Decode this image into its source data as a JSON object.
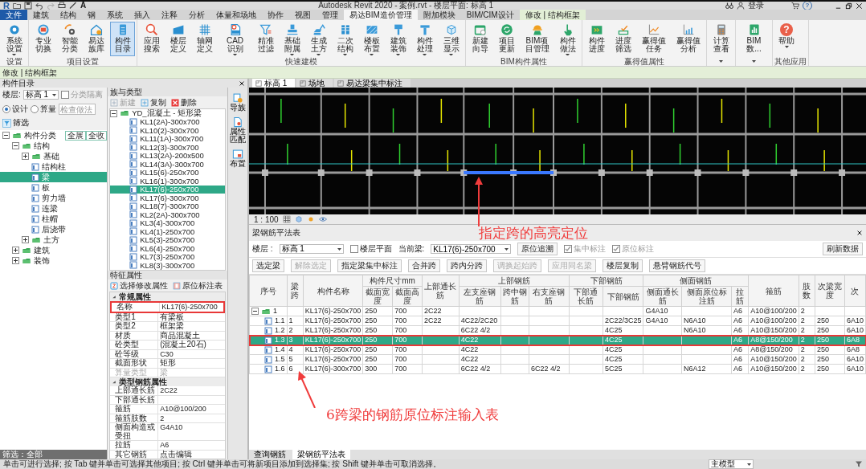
{
  "title_bar": {
    "logo": "R",
    "text_tool": "A",
    "title": "Autodesk Revit 2020 - 案例.rvt - 楼层平面: 标高 1",
    "user": "登录",
    "help": "?"
  },
  "tabs": [
    {
      "label": "文件",
      "kind": "file",
      "selected": false
    },
    {
      "label": "建筑",
      "kind": "normal",
      "selected": false
    },
    {
      "label": "结构",
      "kind": "normal",
      "selected": false
    },
    {
      "label": "钢",
      "kind": "normal",
      "selected": false
    },
    {
      "label": "系统",
      "kind": "normal",
      "selected": false
    },
    {
      "label": "插入",
      "kind": "normal",
      "selected": false
    },
    {
      "label": "注释",
      "kind": "normal",
      "selected": false
    },
    {
      "label": "分析",
      "kind": "normal",
      "selected": false
    },
    {
      "label": "体量和场地",
      "kind": "normal",
      "selected": false
    },
    {
      "label": "协作",
      "kind": "normal",
      "selected": false
    },
    {
      "label": "视图",
      "kind": "normal",
      "selected": false
    },
    {
      "label": "管理",
      "kind": "normal",
      "selected": false
    },
    {
      "label": "易达BIM造价管理",
      "kind": "normal",
      "selected": true
    },
    {
      "label": "附加模块",
      "kind": "normal",
      "selected": false
    },
    {
      "label": "BIM/CIM设计",
      "kind": "normal",
      "selected": false
    },
    {
      "label": "修改 | 结构框架",
      "kind": "context",
      "selected": false
    }
  ],
  "ribbon": {
    "groups": [
      {
        "label": "设置",
        "buttons": [
          {
            "label": "系统设置",
            "dropdown": true,
            "selected": false
          }
        ]
      },
      {
        "label": "项目设置",
        "buttons": [
          {
            "label": "专业切换",
            "dropdown": false,
            "selected": false
          },
          {
            "label": "智能分类",
            "dropdown": false,
            "selected": false
          },
          {
            "label": "易达族库",
            "dropdown": false,
            "selected": false
          },
          {
            "label": "构件目录",
            "dropdown": false,
            "selected": true
          }
        ]
      },
      {
        "label": "快速建模",
        "buttons": [
          {
            "label": "应用搜索",
            "dropdown": false,
            "selected": false
          },
          {
            "label": "楼层定义",
            "dropdown": false,
            "selected": false
          },
          {
            "label": "轴网定义",
            "dropdown": false,
            "selected": false
          },
          {
            "label": "CAD识别",
            "dropdown": true,
            "selected": false
          },
          {
            "label": "精准过滤",
            "dropdown": false,
            "selected": false
          },
          {
            "label": "基础附属",
            "dropdown": true,
            "selected": false
          },
          {
            "label": "生成土方",
            "dropdown": true,
            "selected": false
          },
          {
            "label": "二次结构",
            "dropdown": true,
            "selected": false
          },
          {
            "label": "楼板布置",
            "dropdown": true,
            "selected": false
          },
          {
            "label": "建筑装饰",
            "dropdown": true,
            "selected": false
          },
          {
            "label": "构件处理",
            "dropdown": true,
            "selected": false
          },
          {
            "label": "三维显示",
            "dropdown": true,
            "selected": false
          }
        ]
      },
      {
        "label": "BIM构件属性",
        "buttons": [
          {
            "label": "新建向导",
            "dropdown": false,
            "selected": false
          },
          {
            "label": "项目更新",
            "dropdown": false,
            "selected": false
          },
          {
            "label": "BIM项目管理",
            "dropdown": false,
            "selected": false
          },
          {
            "label": "构件做法",
            "dropdown": true,
            "selected": false
          }
        ]
      },
      {
        "label": "赢得值属性",
        "buttons": [
          {
            "label": "构件进度",
            "dropdown": false,
            "selected": false
          },
          {
            "label": "进度筛选",
            "dropdown": false,
            "selected": false
          },
          {
            "label": "赢得值任务",
            "dropdown": false,
            "selected": false
          },
          {
            "label": "赢得值分析",
            "dropdown": false,
            "selected": false
          }
        ]
      },
      {
        "buttons": [
          {
            "label": "计算查看",
            "dropdown": false,
            "selected": false
          }
        ]
      },
      {
        "buttons": [
          {
            "label": "BIM数...",
            "dropdown": false,
            "selected": false
          }
        ]
      },
      {
        "label": "其他应用",
        "buttons": [
          {
            "label": "帮助",
            "dropdown": true,
            "selected": false,
            "glyph": "?"
          }
        ]
      }
    ]
  },
  "context_bar": "修改 | 结构框架",
  "component_panel": {
    "title": "构件目录",
    "floor_label": "楼层:",
    "floor_value": "标高 1",
    "isolate": {
      "label": "分类隔离",
      "checked": false,
      "disabled": true
    },
    "modes": [
      {
        "label": "设计",
        "selected": true
      },
      {
        "label": "算量",
        "selected": false
      }
    ],
    "search_placeholder": "检查做法",
    "filter_button": "筛选",
    "expand_all": "全展",
    "collapse_all": "全收",
    "tree": [
      {
        "label": "构件分类",
        "kind": "group",
        "expanded": true,
        "selected": false,
        "children": [
          {
            "label": "结构",
            "kind": "group",
            "expanded": true,
            "selected": false,
            "children": [
              {
                "label": "基础",
                "kind": "group",
                "expanded": false,
                "selected": false
              },
              {
                "label": "结构柱",
                "kind": "item",
                "selected": false
              },
              {
                "label": "梁",
                "kind": "item",
                "selected": true
              },
              {
                "label": "板",
                "kind": "item",
                "selected": false
              },
              {
                "label": "剪力墙",
                "kind": "item",
                "selected": false
              },
              {
                "label": "连梁",
                "kind": "item",
                "selected": false
              },
              {
                "label": "柱帽",
                "kind": "item",
                "selected": false
              },
              {
                "label": "后浇带",
                "kind": "item",
                "selected": false
              },
              {
                "label": "土方",
                "kind": "group",
                "expanded": false,
                "selected": false
              }
            ]
          },
          {
            "label": "建筑",
            "kind": "group",
            "expanded": false,
            "selected": false
          },
          {
            "label": "装饰",
            "kind": "group",
            "expanded": false,
            "selected": false
          }
        ]
      }
    ],
    "footer": "筛选：全部"
  },
  "family_panel": {
    "title": "族与类型",
    "actions": [
      {
        "label": "新建",
        "disabled": true
      },
      {
        "label": "复制",
        "disabled": false
      },
      {
        "label": "删除",
        "disabled": false
      }
    ],
    "root": {
      "label": "YD_混凝土 - 矩形梁",
      "expanded": true,
      "children": [
        {
          "label": "KL1(2A)-300x700",
          "selected": false
        },
        {
          "label": "KL10(2)-300x700",
          "selected": false
        },
        {
          "label": "KL11(1A)-300x700",
          "selected": false
        },
        {
          "label": "KL12(3)-300x700",
          "selected": false
        },
        {
          "label": "KL13(2A)-200x500",
          "selected": false
        },
        {
          "label": "KL14(3A)-300x700",
          "selected": false
        },
        {
          "label": "KL15(6)-250x700",
          "selected": false
        },
        {
          "label": "KL16(1)-300x700",
          "selected": false
        },
        {
          "label": "KL17(6)-250x700",
          "selected": true
        },
        {
          "label": "KL17(6)-300x700",
          "selected": false
        },
        {
          "label": "KL18(7)-300x700",
          "selected": false
        },
        {
          "label": "KL2(2A)-300x700",
          "selected": false
        },
        {
          "label": "KL3(4)-300x700",
          "selected": false
        },
        {
          "label": "KL4(1)-250x700",
          "selected": false
        },
        {
          "label": "KL5(3)-250x700",
          "selected": false
        },
        {
          "label": "KL6(4)-250x700",
          "selected": false
        },
        {
          "label": "KL7(3)-250x700",
          "selected": false
        },
        {
          "label": "KL8(3)-300x700",
          "selected": false
        }
      ]
    }
  },
  "side_tools": [
    {
      "label": "导族"
    },
    {
      "label": "属性匹配"
    },
    {
      "label": "布置"
    }
  ],
  "properties": {
    "title": "特征属性",
    "actions": [
      "选择修改属性",
      "原位标注表"
    ],
    "sections": [
      {
        "label": "常规属性",
        "expanded": true,
        "rows": [
          {
            "label": "名称",
            "value": "KL17(6)-250x700",
            "disabled": false,
            "outlined": true
          },
          {
            "label": "类型1",
            "value": "有梁板",
            "disabled": false,
            "outlined": false
          },
          {
            "label": "类型2",
            "value": "框架梁",
            "disabled": false,
            "outlined": false
          },
          {
            "label": "材质",
            "value": "商品混凝土",
            "disabled": false,
            "outlined": false
          },
          {
            "label": "砼类型",
            "value": "(混凝土20石)",
            "disabled": false,
            "outlined": false
          },
          {
            "label": "砼等级",
            "value": "C30",
            "disabled": false,
            "outlined": false
          },
          {
            "label": "截面形状",
            "value": "矩形",
            "disabled": false,
            "outlined": false
          },
          {
            "label": "算量类型",
            "value": "梁",
            "disabled": true,
            "outlined": false
          }
        ]
      },
      {
        "label": "类型钢筋属性",
        "expanded": true,
        "rows": [
          {
            "label": "上部通长筋",
            "value": "2C22",
            "disabled": false,
            "outlined": false
          },
          {
            "label": "下部通长筋",
            "disabled": false,
            "outlined": false
          },
          {
            "label": "箍筋",
            "value": "A10@100/200",
            "disabled": false,
            "outlined": false
          },
          {
            "label": "箍筋肢数",
            "value": "2",
            "disabled": false,
            "outlined": false
          },
          {
            "label": "侧面构造或受扭",
            "value": "G4A10",
            "disabled": false,
            "outlined": false
          },
          {
            "label": "拉筋",
            "value": "A6",
            "disabled": false,
            "outlined": false
          },
          {
            "label": "其它钢筋",
            "value": "点击编辑",
            "disabled": false,
            "outlined": false
          }
        ]
      }
    ]
  },
  "view_tabs": [
    {
      "label": "标高 1",
      "selected": true
    },
    {
      "label": "场地",
      "selected": false
    },
    {
      "label": "易达梁集中标注",
      "selected": false
    }
  ],
  "view_scale": "1 : 100",
  "rebar_table": {
    "title": "梁钢筋平法表",
    "callout": "指定跨的高亮定位",
    "floor_label": "楼层 :",
    "floor_value": "标高 1",
    "floor_plan": {
      "label": "楼层平面",
      "checked": false,
      "disabled": false
    },
    "beam_label": "当前梁:",
    "beam_value": "KL17(6)-250x700",
    "trace_button": "原位追溯",
    "options": [
      {
        "label": "集中标注",
        "checked": true,
        "disabled": true
      },
      {
        "label": "原位标注",
        "checked": true,
        "disabled": true
      }
    ],
    "refresh_button": "刷新数据",
    "actions": [
      {
        "label": "选定梁",
        "disabled": false
      },
      {
        "label": "解除选定",
        "disabled": true
      },
      {
        "label": "指定梁集中标注",
        "disabled": false
      },
      {
        "label": "合并跨",
        "disabled": false
      },
      {
        "label": "跨内分跨",
        "disabled": false
      },
      {
        "label": "调换起始跨",
        "disabled": true
      },
      {
        "label": "应用同名梁",
        "disabled": true
      },
      {
        "label": "楼层复制",
        "disabled": false
      },
      {
        "label": "悬臂钢筋代号",
        "disabled": false
      }
    ],
    "columns": [
      {
        "label": "序号"
      },
      {
        "label": "梁跨"
      },
      {
        "label": "构件名称"
      },
      {
        "label": "构件尺寸mm",
        "colspan": 2,
        "children": [
          "截面宽度",
          "截面高度"
        ]
      },
      {
        "label": "上部通长筋"
      },
      {
        "label": "上部钢筋",
        "colspan": 3,
        "children": [
          "左支座钢筋",
          "跨中钢筋",
          "右支座钢筋"
        ]
      },
      {
        "label": "下部钢筋",
        "colspan": 2,
        "children": [
          "下部通长筋",
          "下部钢筋"
        ]
      },
      {
        "label": "侧面钢筋",
        "colspan": 3,
        "children": [
          "侧面通长筋",
          "侧面原位标注筋",
          "拉筋"
        ]
      },
      {
        "label": "箍筋"
      },
      {
        "label": "肢数"
      },
      {
        "label": "次梁宽度"
      },
      {
        "label": "次"
      }
    ],
    "rows": [
      {
        "expanded": true,
        "selected": false,
        "outlined": false,
        "cells": [
          "1",
          "",
          "KL17(6)-250x700",
          "250",
          "700",
          "2C22",
          "",
          "",
          "",
          "",
          "",
          "G4A10",
          "",
          "A6",
          "A10@100/200",
          "2",
          "",
          ""
        ],
        "children": [
          {
            "selected": false,
            "outlined": false,
            "cells": [
              "1.1",
              "1",
              "KL17(6)-250x700",
              "250",
              "700",
              "2C22",
              "4C22/2C20",
              "",
              "",
              "",
              "2C22/3C25",
              "G4A10",
              "N6A10",
              "A6",
              "A10@100/200",
              "2",
              "250",
              "6A10"
            ]
          },
          {
            "selected": false,
            "outlined": false,
            "cells": [
              "1.2",
              "2",
              "KL17(6)-250x700",
              "250",
              "700",
              "",
              "6C22 4/2",
              "",
              "",
              "",
              "4C25",
              "",
              "N6A10",
              "A6",
              "A10@150/200",
              "2",
              "250",
              "6A10"
            ]
          },
          {
            "selected": true,
            "outlined": true,
            "cells": [
              "1.3",
              "3",
              "KL17(6)-250x700",
              "250",
              "700",
              "",
              "4C22",
              "",
              "",
              "",
              "4C25",
              "",
              "",
              "A6",
              "A8@150/200",
              "2",
              "250",
              "6A8"
            ]
          },
          {
            "selected": false,
            "outlined": false,
            "cells": [
              "1.4",
              "4",
              "KL17(6)-250x700",
              "250",
              "700",
              "",
              "4C22",
              "",
              "",
              "",
              "4C25",
              "",
              "",
              "A6",
              "A8@150/200",
              "2",
              "250",
              "6A8"
            ]
          },
          {
            "selected": false,
            "outlined": false,
            "cells": [
              "1.5",
              "5",
              "KL17(6)-250x700",
              "250",
              "700",
              "",
              "4C22",
              "",
              "",
              "",
              "4C25",
              "",
              "",
              "A6",
              "A10@150/200",
              "2",
              "250",
              "6A10"
            ]
          },
          {
            "selected": false,
            "outlined": false,
            "cells": [
              "1.6",
              "6",
              "KL17(6)-300x700",
              "300",
              "700",
              "",
              "6C22 4/2",
              "",
              "6C22 4/2",
              "",
              "5C25",
              "",
              "N6A12",
              "A6",
              "A10@150/200",
              "2",
              "250",
              "6A10"
            ]
          }
        ]
      }
    ],
    "callout_bottom": "6跨梁的钢筋原位标注输入表"
  },
  "bottom_tabs": [
    {
      "label": "查询钢筋",
      "selected": false
    },
    {
      "label": "梁钢筋平法表",
      "selected": true
    }
  ],
  "status_bar": {
    "text": "单击可进行选择; 按 Tab 键并单击可选择其他项目; 按 Ctrl 键并单击可将新项目添加到选择集; 按 Shift 键并单击可取消选择。",
    "model": "主模型"
  }
}
